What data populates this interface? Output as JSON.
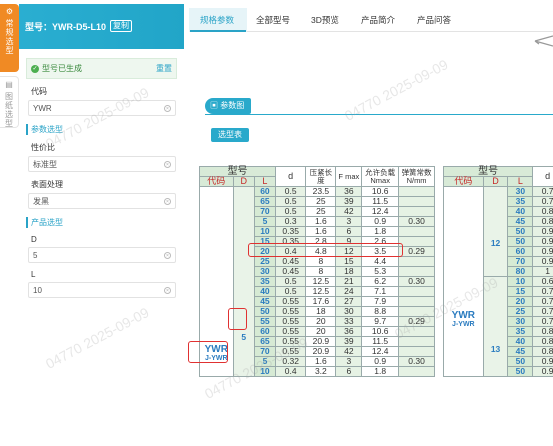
{
  "sidebar_tabs": [
    {
      "label": "常规选型",
      "icon": "settings-icon"
    },
    {
      "label": "图纸选型",
      "icon": "drawing-icon"
    }
  ],
  "panel": {
    "model_label": "型号：YWR-D5-L10",
    "copy_label": "复制",
    "generated_text": "型号已生成",
    "reset_label": "重置",
    "code_label": "代码",
    "code_value": "YWR",
    "param_section": "参数选型",
    "price_label": "性价比",
    "price_value": "标准型",
    "surface_label": "表面处理",
    "surface_value": "发黑",
    "product_section": "产品选型",
    "d_label": "D",
    "d_value": "5",
    "l_label": "L",
    "l_value": "10"
  },
  "tabs": [
    "规格参数",
    "全部型号",
    "3D预览",
    "产品简介",
    "产品问答"
  ],
  "param_header": "参数图",
  "select_table_btn": "选型表",
  "watermark": "04770  2025-09-09",
  "table": {
    "h_model": "型号",
    "h_code": "代码",
    "h_D": "D",
    "h_L": "L",
    "h_d": "d",
    "h_press": "压紧长度",
    "h_F": "F max",
    "h_load": "允许负载 Nmax",
    "h_spring": "弹簧常数 N/mm",
    "code_main": "YWR",
    "code_sub": "J-YWR",
    "rows": [
      {
        "D": "",
        "L": "60",
        "d": "0.5",
        "press": "23.5",
        "F": "36",
        "N": "10.6",
        "k": ""
      },
      {
        "D": "",
        "L": "65",
        "d": "0.5",
        "press": "25",
        "F": "39",
        "N": "11.5",
        "k": ""
      },
      {
        "D": "",
        "L": "70",
        "d": "0.5",
        "press": "25",
        "F": "42",
        "N": "12.4",
        "k": ""
      },
      {
        "D": "",
        "L": "5",
        "d": "0.3",
        "press": "1.6",
        "F": "3",
        "N": "0.9",
        "k": "0.30"
      },
      {
        "D": "",
        "L": "10",
        "d": "0.35",
        "press": "1.6",
        "F": "6",
        "N": "1.8",
        "k": ""
      },
      {
        "D": "",
        "L": "15",
        "d": "0.35",
        "press": "2.8",
        "F": "9",
        "N": "2.6",
        "k": ""
      },
      {
        "D": "",
        "L": "20",
        "d": "0.4",
        "press": "4.8",
        "F": "12",
        "N": "3.5",
        "k": "0.29"
      },
      {
        "D": "",
        "L": "25",
        "d": "0.45",
        "press": "8",
        "F": "15",
        "N": "4.4",
        "k": ""
      },
      {
        "D": "",
        "L": "30",
        "d": "0.45",
        "press": "8",
        "F": "18",
        "N": "5.3",
        "k": ""
      },
      {
        "D": "5",
        "L": "35",
        "d": "0.5",
        "press": "12.5",
        "F": "21",
        "N": "6.2",
        "k": "0.30"
      },
      {
        "D": "",
        "L": "40",
        "d": "0.5",
        "press": "12.5",
        "F": "24",
        "N": "7.1",
        "k": ""
      },
      {
        "D": "",
        "L": "45",
        "d": "0.55",
        "press": "17.6",
        "F": "27",
        "N": "7.9",
        "k": ""
      },
      {
        "D": "",
        "L": "50",
        "d": "0.55",
        "press": "18",
        "F": "30",
        "N": "8.8",
        "k": ""
      },
      {
        "D": "",
        "L": "55",
        "d": "0.55",
        "press": "20",
        "F": "33",
        "N": "9.7",
        "k": "0.29"
      },
      {
        "D": "",
        "L": "60",
        "d": "0.55",
        "press": "20",
        "F": "36",
        "N": "10.6",
        "k": ""
      },
      {
        "D": "",
        "L": "65",
        "d": "0.55",
        "press": "20.9",
        "F": "39",
        "N": "11.5",
        "k": ""
      },
      {
        "D": "",
        "L": "70",
        "d": "0.55",
        "press": "20.9",
        "F": "42",
        "N": "12.4",
        "k": ""
      },
      {
        "D": "",
        "L": "5",
        "d": "0.32",
        "press": "1.6",
        "F": "3",
        "N": "0.9",
        "k": "0.30"
      },
      {
        "D": "",
        "L": "10",
        "d": "0.4",
        "press": "3.2",
        "F": "6",
        "N": "1.8",
        "k": ""
      }
    ],
    "right": {
      "h_model": "型号",
      "h_code": "代码",
      "h_D": "D",
      "h_L": "L",
      "h_d": "d",
      "code_main": "YWR",
      "code_sub": "J-YWR",
      "D12": "12",
      "D13": "13",
      "rows": [
        {
          "L": "30",
          "d": "0.7"
        },
        {
          "L": "35",
          "d": "0.7"
        },
        {
          "L": "40",
          "d": "0.8"
        },
        {
          "L": "45",
          "d": "0.8"
        },
        {
          "L": "50",
          "d": "0.9"
        },
        {
          "L": "50",
          "d": "0.9"
        },
        {
          "L": "60",
          "d": "0.9"
        },
        {
          "L": "70",
          "d": "0.9"
        },
        {
          "L": "80",
          "d": "1"
        },
        {
          "L": "10",
          "d": "0.6"
        },
        {
          "L": "15",
          "d": "0.7"
        },
        {
          "L": "20",
          "d": "0.7"
        },
        {
          "L": "25",
          "d": "0.7"
        },
        {
          "L": "30",
          "d": "0.7"
        },
        {
          "L": "35",
          "d": "0.8"
        },
        {
          "L": "40",
          "d": "0.8"
        },
        {
          "L": "45",
          "d": "0.8"
        },
        {
          "L": "50",
          "d": "0.9"
        },
        {
          "L": "50",
          "d": "0.9"
        }
      ]
    }
  }
}
